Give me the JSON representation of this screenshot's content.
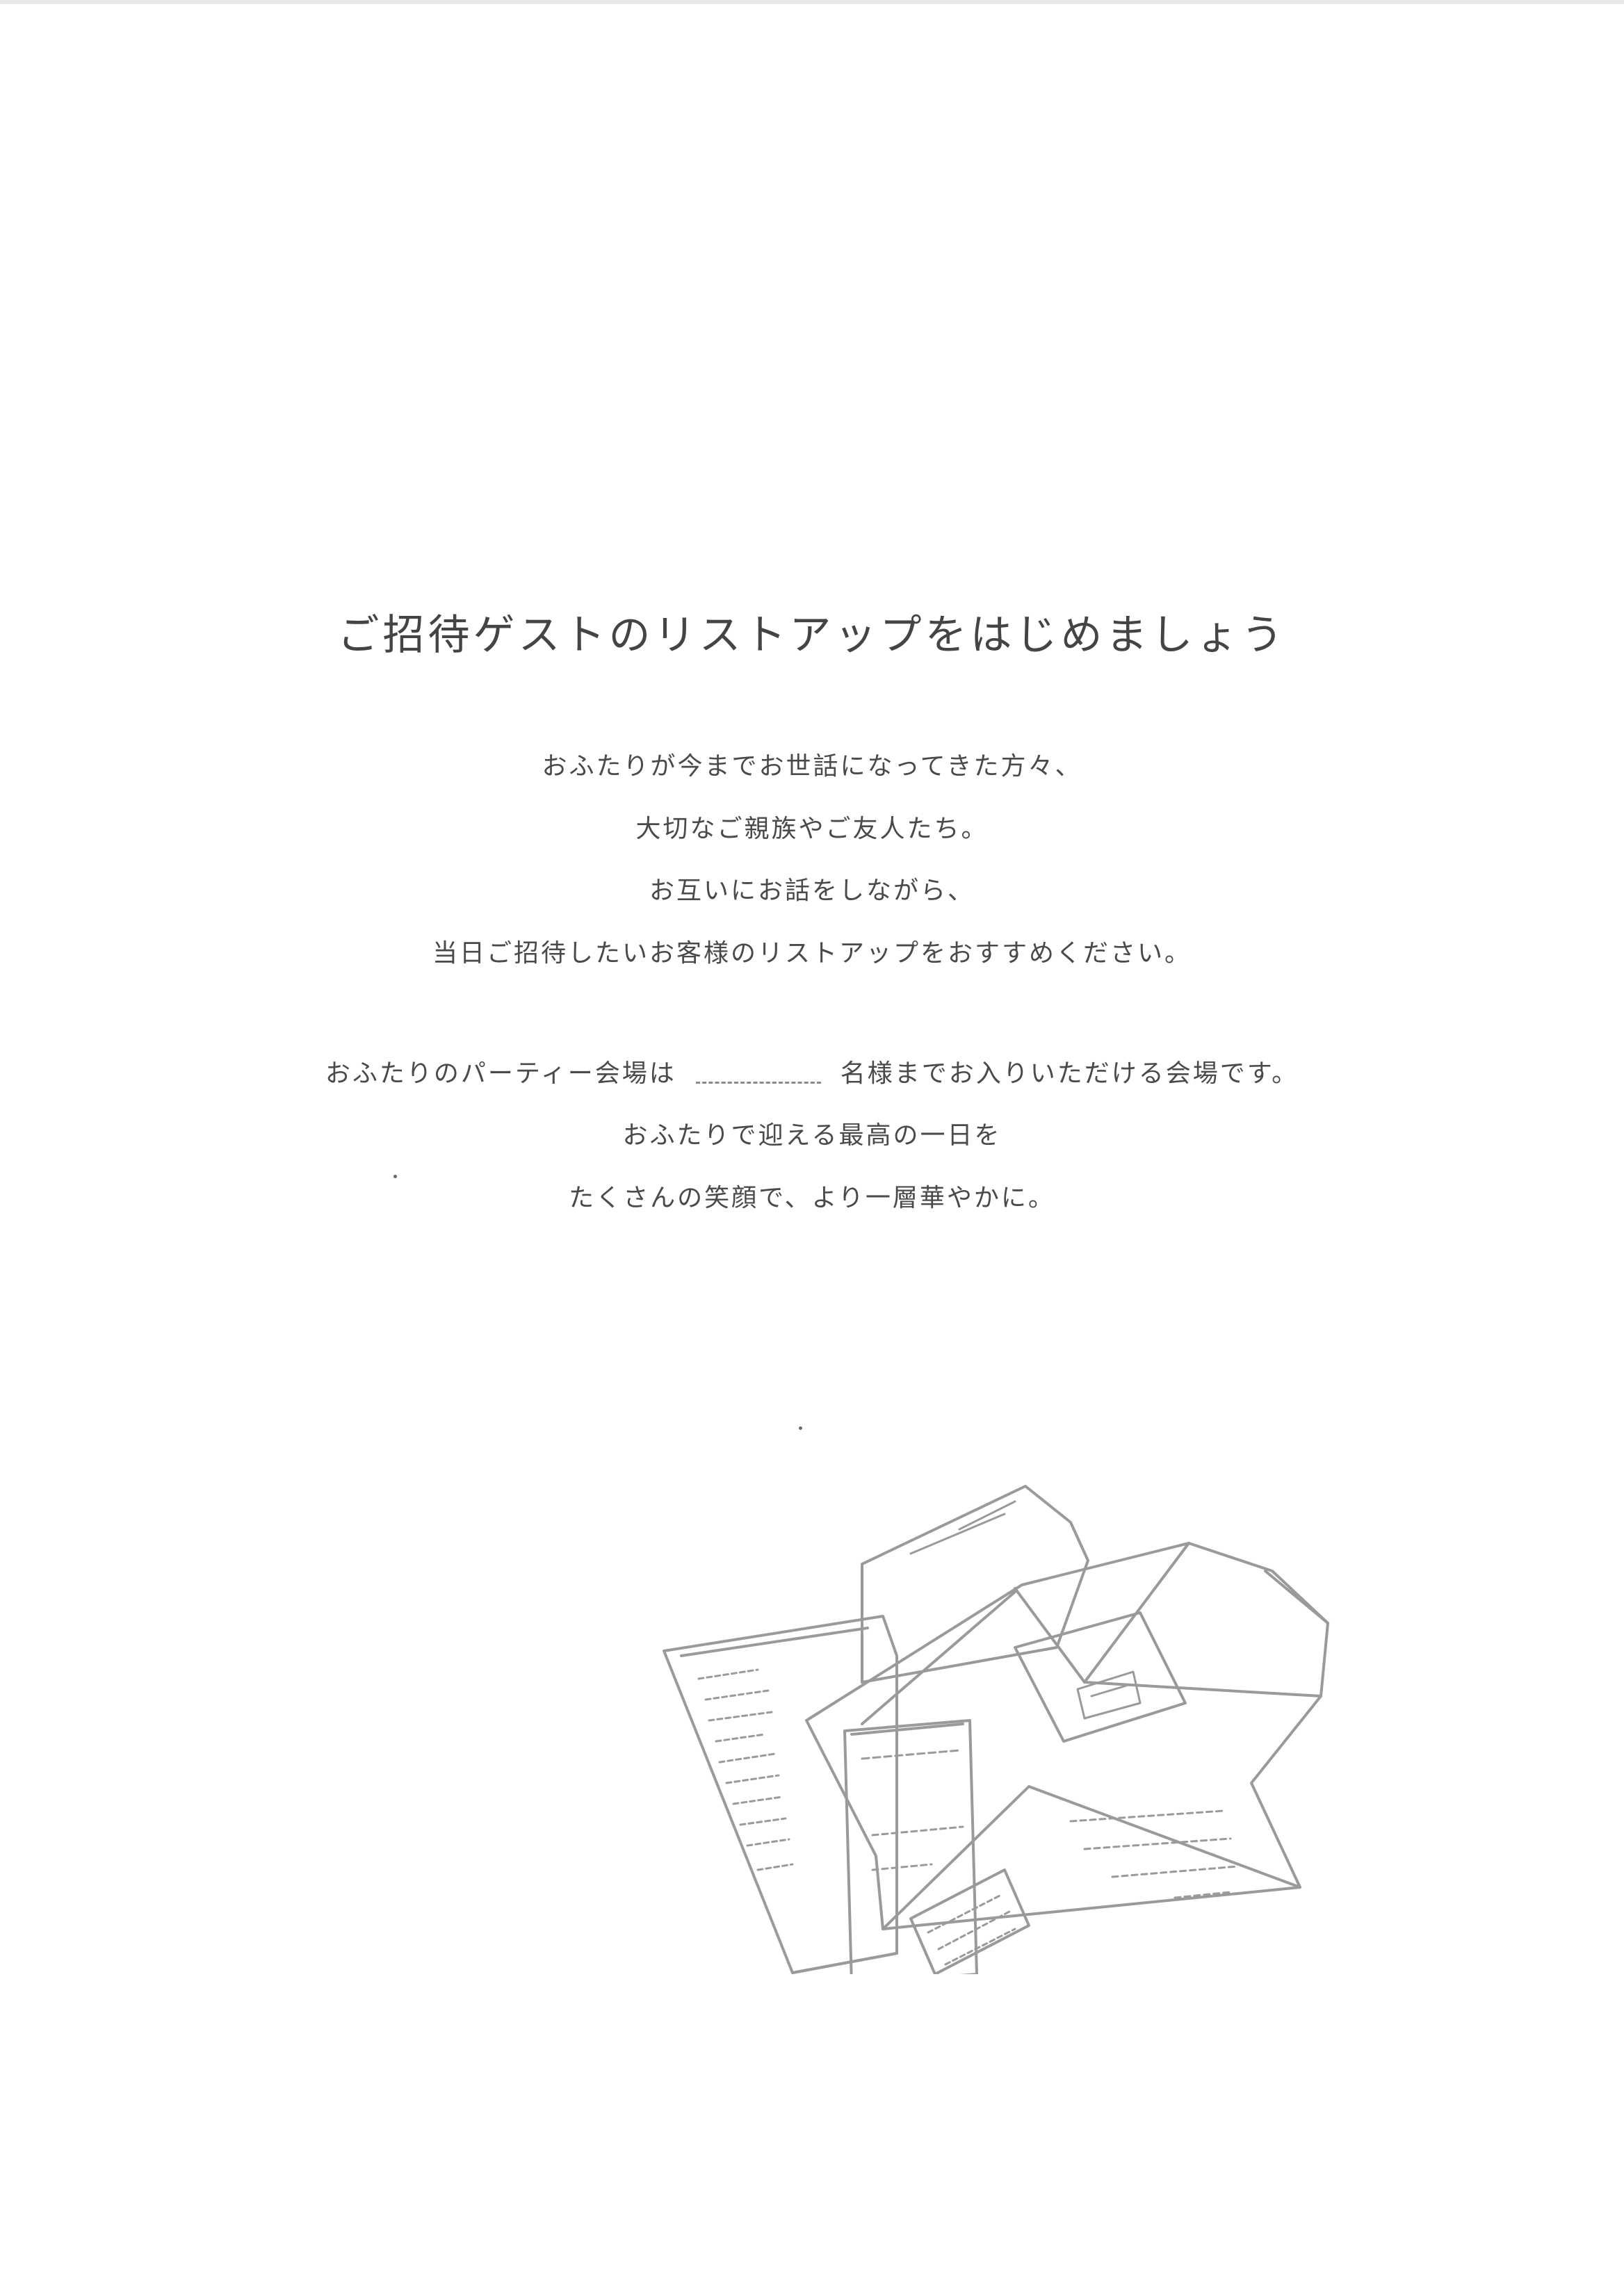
{
  "document": {
    "heading": "ご招待ゲストのリストアップをはじめましょう",
    "paragraph1": [
      "おふたりが今までお世話になってきた方々、",
      "大切なご親族やご友人たち。",
      "お互いにお話をしながら、",
      "当日ご招待したいお客様のリストアップをおすすめください。"
    ],
    "capacity_sentence": {
      "before": "おふたりのパーティー会場は",
      "after": "名様までお入りいただける会場です。"
    },
    "paragraph2": [
      "おふたりで迎える最高の一日を",
      "たくさんの笑顔で、より一層華やかに。"
    ]
  },
  "illustration": {
    "icon": "invitation-envelopes-illustration",
    "stroke_color": "#9a9a9a"
  }
}
